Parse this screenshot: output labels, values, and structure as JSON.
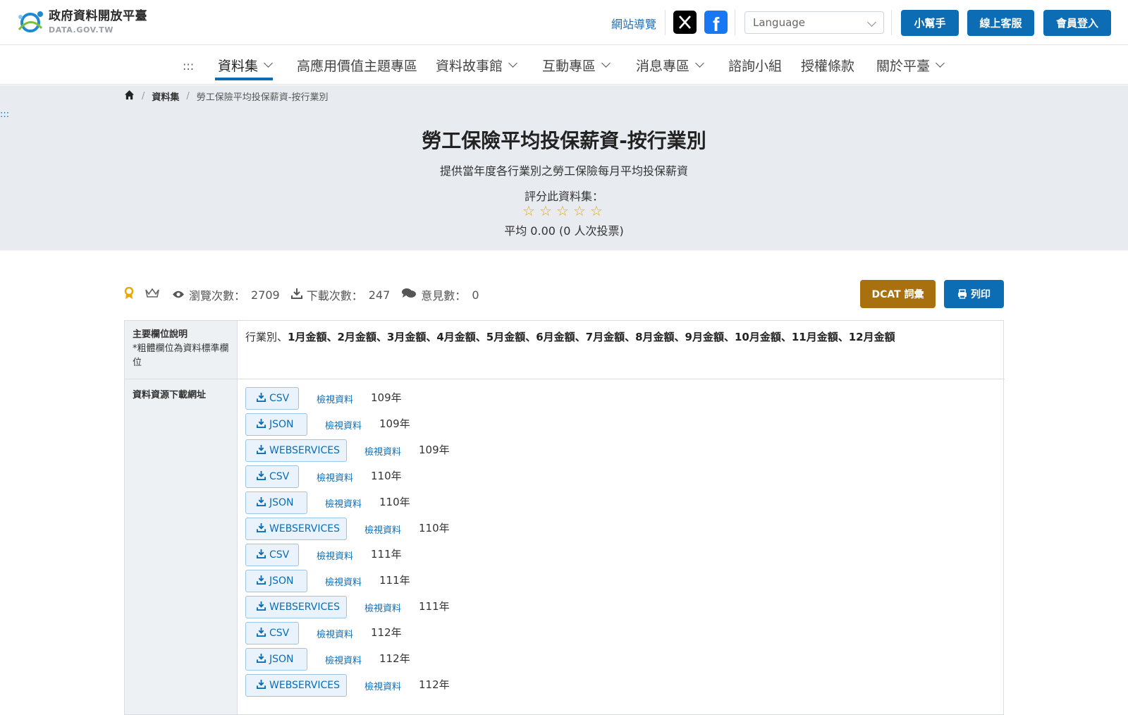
{
  "header": {
    "logo_title": "政府資料開放平臺",
    "logo_sub": "DATA.GOV.TW",
    "sitemap": "網站導覽",
    "language_placeholder": "Language",
    "buttons": [
      "小幫手",
      "線上客服",
      "會員登入"
    ]
  },
  "nav": {
    "dots": ":::",
    "items": [
      "資料集",
      "高應用價值主題專區",
      "資料故事館",
      "互動專區",
      "消息專區",
      "諮詢小組",
      "授權條款",
      "關於平臺"
    ]
  },
  "breadcrumb": {
    "level1": "資料集",
    "current": "勞工保險平均投保薪資-按行業別"
  },
  "side_dots": ":::",
  "dataset": {
    "title": "勞工保險平均投保薪資-按行業別",
    "description": "提供當年度各行業別之勞工保險每月平均投保薪資",
    "rate_label": "評分此資料集：",
    "rating_value": 0,
    "rating_max": 5,
    "average_text": "平均 0.00 (0 人次投票)"
  },
  "stats": {
    "views_label": "瀏覽次數：",
    "views": "2709",
    "downloads_label": "下載次數：",
    "downloads": "247",
    "comments_label": "意見數：",
    "comments": "0"
  },
  "actions": {
    "dcat": "DCAT 詞彙",
    "print": "列印"
  },
  "table": {
    "fields_label": "主要欄位說明",
    "fields_note": "*粗體欄位為資料標準欄位",
    "fields_plain": "行業別、",
    "fields_bold": "1月金額、2月金額、3月金額、4月金額、5月金額、6月金額、7月金額、8月金額、9月金額、10月金額、11月金額、12月金額",
    "downloads_label": "資料資源下載網址",
    "view_label": "檢視資料",
    "resources": [
      {
        "format": "CSV",
        "year": "109年"
      },
      {
        "format": "JSON",
        "year": "109年"
      },
      {
        "format": "WEBSERVICES",
        "year": "109年"
      },
      {
        "format": "CSV",
        "year": "110年"
      },
      {
        "format": "JSON",
        "year": "110年"
      },
      {
        "format": "WEBSERVICES",
        "year": "110年"
      },
      {
        "format": "CSV",
        "year": "111年"
      },
      {
        "format": "JSON",
        "year": "111年"
      },
      {
        "format": "WEBSERVICES",
        "year": "111年"
      },
      {
        "format": "CSV",
        "year": "112年"
      },
      {
        "format": "JSON",
        "year": "112年"
      },
      {
        "format": "WEBSERVICES",
        "year": "112年"
      }
    ]
  },
  "colors": {
    "primary": "#0c6db5",
    "dcat": "#a8700e",
    "hero_bg": "#e8ecf0",
    "star": "#e8a80c"
  }
}
